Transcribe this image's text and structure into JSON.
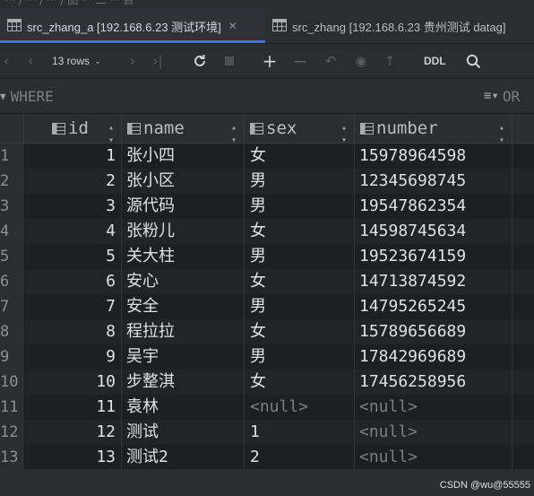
{
  "tabs": [
    {
      "label": "src_zhang_a [192.168.6.23 测试环境]",
      "active": true
    },
    {
      "label": "src_zhang [192.168.6.23 贵州测试 datag]",
      "active": false
    }
  ],
  "toolbar": {
    "rows_label": "13 rows",
    "ddl_label": "DDL"
  },
  "filter": {
    "where_label": "WHERE",
    "orderby_label": "OR"
  },
  "columns": [
    "id",
    "name",
    "sex",
    "number"
  ],
  "rows": [
    {
      "rn": "1",
      "id": "1",
      "name": "张小四",
      "sex": "女",
      "number": "15978964598"
    },
    {
      "rn": "2",
      "id": "2",
      "name": "张小区",
      "sex": "男",
      "number": "12345698745"
    },
    {
      "rn": "3",
      "id": "3",
      "name": "源代码",
      "sex": "男",
      "number": "19547862354"
    },
    {
      "rn": "4",
      "id": "4",
      "name": "张粉儿",
      "sex": "女",
      "number": "14598745634"
    },
    {
      "rn": "5",
      "id": "5",
      "name": "关大柱",
      "sex": "男",
      "number": "19523674159"
    },
    {
      "rn": "6",
      "id": "6",
      "name": "安心",
      "sex": "女",
      "number": "14713874592"
    },
    {
      "rn": "7",
      "id": "7",
      "name": "安全",
      "sex": "男",
      "number": "14795265245"
    },
    {
      "rn": "8",
      "id": "8",
      "name": "程拉拉",
      "sex": "女",
      "number": "15789656689"
    },
    {
      "rn": "9",
      "id": "9",
      "name": "吴宇",
      "sex": "男",
      "number": "17842969689"
    },
    {
      "rn": "10",
      "id": "10",
      "name": "步整淇",
      "sex": "女",
      "number": "17456258956"
    },
    {
      "rn": "11",
      "id": "11",
      "name": "袁林",
      "sex": "<null>",
      "number": "<null>"
    },
    {
      "rn": "12",
      "id": "12",
      "name": "测试",
      "sex": "1",
      "number": "<null>"
    },
    {
      "rn": "13",
      "id": "13",
      "name": "测试2",
      "sex": "2",
      "number": "<null>"
    }
  ],
  "watermark": "CSDN @wu@55555",
  "colors": {
    "accent": "#3574f0",
    "background": "#1e1f22",
    "panel": "#2b2d30"
  }
}
